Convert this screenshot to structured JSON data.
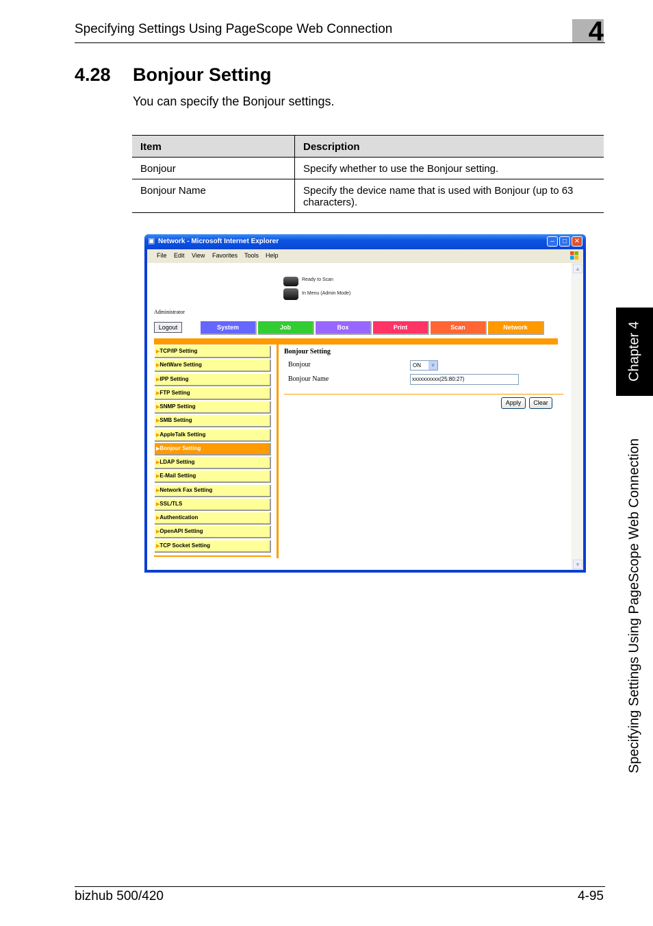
{
  "header": {
    "running_title": "Specifying Settings Using PageScope Web Connection",
    "chapter_number": "4"
  },
  "section": {
    "number": "4.28",
    "title": "Bonjour Setting",
    "intro": "You can specify the Bonjour settings."
  },
  "table": {
    "headers": [
      "Item",
      "Description"
    ],
    "rows": [
      [
        "Bonjour",
        "Specify whether to use the Bonjour setting."
      ],
      [
        "Bonjour Name",
        "Specify the device name that is used with Bonjour (up to 63 characters)."
      ]
    ]
  },
  "side_tab": {
    "chapter": "Chapter 4",
    "section": "Specifying Settings Using PageScope Web Connection"
  },
  "footer": {
    "model": "bizhub 500/420",
    "page": "4-95"
  },
  "browser": {
    "title": "Network - Microsoft Internet Explorer",
    "menu": [
      "File",
      "Edit",
      "View",
      "Favorites",
      "Tools",
      "Help"
    ],
    "icons": {
      "app": "ie-icon",
      "minimize": "minimize-icon",
      "maximize": "maximize-icon",
      "close": "close-icon",
      "brand": "windows-logo-icon"
    }
  },
  "web": {
    "status": [
      "Ready to Scan",
      "In Menu (Admin Mode)"
    ],
    "user": "Administrator",
    "logout": "Logout",
    "tabs": [
      {
        "label": "System",
        "color": "#6666ff"
      },
      {
        "label": "Job",
        "color": "#33cc33"
      },
      {
        "label": "Box",
        "color": "#9966ff"
      },
      {
        "label": "Print",
        "color": "#ff3366"
      },
      {
        "label": "Scan",
        "color": "#ff6633"
      },
      {
        "label": "Network",
        "color": "#ff9900"
      }
    ],
    "nav": [
      "TCP/IP Setting",
      "NetWare Setting",
      "IPP Setting",
      "FTP Setting",
      "SNMP Setting",
      "SMB Setting",
      "AppleTalk Setting",
      "Bonjour Setting",
      "LDAP Setting",
      "E-Mail Setting",
      "Network Fax Setting",
      "SSL/TLS",
      "Authentication",
      "OpenAPI Setting",
      "TCP Socket Setting"
    ],
    "active_nav": "Bonjour Setting",
    "accent_color": "#ff9a00",
    "form": {
      "title": "Bonjour Setting",
      "bonjour_label": "Bonjour",
      "bonjour_value": "ON",
      "name_label": "Bonjour Name",
      "name_value": "xxxxxxxxxx(25:80:27)",
      "apply": "Apply",
      "clear": "Clear"
    }
  }
}
